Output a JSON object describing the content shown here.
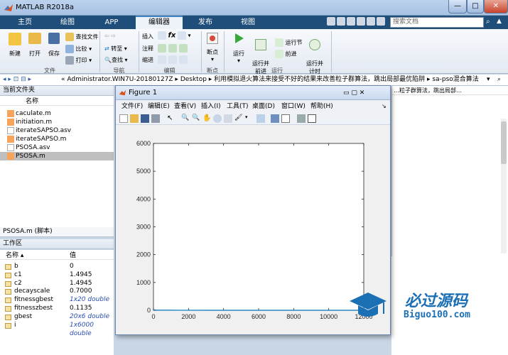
{
  "window": {
    "title": "MATLAB R2018a",
    "min": "—",
    "max": "□",
    "close": "✕"
  },
  "tabs": [
    "主页",
    "绘图",
    "APP",
    "编辑器",
    "发布",
    "视图"
  ],
  "search_placeholder": "搜索文档",
  "ribbon": {
    "file": {
      "new": "新建",
      "open": "打开",
      "save": "保存",
      "find_files": "查找文件",
      "compare": "比较",
      "print": "打印",
      "label": "文件"
    },
    "nav": {
      "goto": "转至",
      "find": "查找",
      "label": "导航"
    },
    "edit": {
      "insert": "插入",
      "comment": "注释",
      "indent": "缩进",
      "fx": "fx",
      "label": "编辑"
    },
    "breakpoints": {
      "btn": "断点",
      "label": "断点"
    },
    "run": {
      "run": "运行",
      "run_advance": "运行并\n前进",
      "run_section": "运行节",
      "advance": "前进",
      "run_time": "运行并\n计时",
      "label": "运行"
    }
  },
  "address": {
    "path": "« Administrator.WIN7U-20180127Z ▸ Desktop ▸ 利用模拟退火算法来接受不好的结果来改善粒子群算法，跳出局部最优陷阱 ▸ sa-pso混合算法",
    "caret": "▾"
  },
  "current_folder": {
    "header": "当前文件夹",
    "col_name": "名称",
    "files": [
      "caculate.m",
      "initiation.m",
      "iterateSAPSO.asv",
      "iterateSAPSO.m",
      "PSOSA.asv",
      "PSOSA.m"
    ],
    "selected": "PSOSA.m"
  },
  "detail_label": "PSOSA.m  (脚本)",
  "workspace": {
    "header": "工作区",
    "col_name": "名称",
    "col_value": "值",
    "rows": [
      {
        "name": "b",
        "value": "0"
      },
      {
        "name": "c1",
        "value": "1.4945"
      },
      {
        "name": "c2",
        "value": "1.4945"
      },
      {
        "name": "decayscale",
        "value": "0.7000"
      },
      {
        "name": "fitnessgbest",
        "value": "1x20 double"
      },
      {
        "name": "fitnesszbest",
        "value": "0.1135"
      },
      {
        "name": "gbest",
        "value": "20x6 double"
      },
      {
        "name": "i",
        "value": "1x6000 double"
      }
    ]
  },
  "right_pane": {
    "path": "…粒子群算法，跳出局部…"
  },
  "figure": {
    "title": "Figure 1",
    "menu": [
      "文件(F)",
      "编辑(E)",
      "查看(V)",
      "插入(I)",
      "工具(T)",
      "桌面(D)",
      "窗口(W)",
      "帮助(H)"
    ]
  },
  "chart_data": {
    "type": "line",
    "title": "",
    "xlabel": "",
    "ylabel": "",
    "xlim": [
      0,
      12000
    ],
    "ylim": [
      0,
      6000
    ],
    "xticks": [
      0,
      2000,
      4000,
      6000,
      8000,
      10000,
      12000
    ],
    "yticks": [
      0,
      1000,
      2000,
      3000,
      4000,
      5000,
      6000
    ],
    "series": [
      {
        "x": [
          0,
          100,
          200,
          500,
          1000,
          3000,
          6000,
          9000,
          12000
        ],
        "y": [
          15,
          10,
          6,
          3,
          2,
          1,
          0.5,
          0.3,
          0.2
        ],
        "color": "#0072bd"
      }
    ]
  },
  "watermark": {
    "cn": "必过源码",
    "en": "Biguo100.com"
  },
  "colors": {
    "tabbar": "#1e4e79",
    "accent": "#1b6fb5",
    "selected_row": "#bfbfbf"
  }
}
